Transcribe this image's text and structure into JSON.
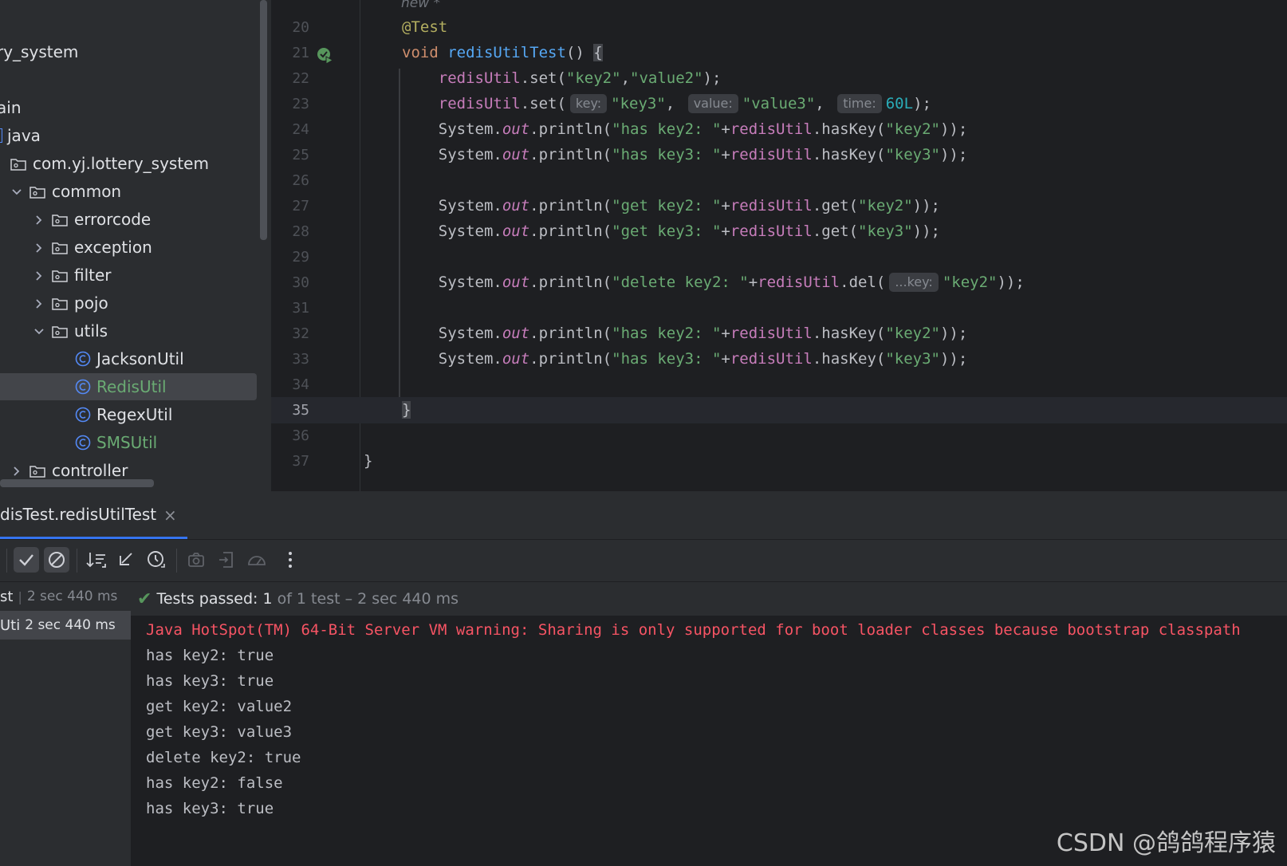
{
  "project_tree": [
    {
      "label": "ry_system",
      "type": "text",
      "depth": -1
    },
    {
      "label": "ain",
      "type": "text",
      "depth": -1
    },
    {
      "label": "java",
      "type": "src-folder",
      "depth": -1
    },
    {
      "label": "com.yj.lottery_system",
      "type": "package",
      "depth": 0
    },
    {
      "label": "common",
      "type": "folder",
      "depth": 1,
      "expanded": true
    },
    {
      "label": "errorcode",
      "type": "folder",
      "depth": 2,
      "expanded": false
    },
    {
      "label": "exception",
      "type": "folder",
      "depth": 2,
      "expanded": false
    },
    {
      "label": "filter",
      "type": "folder",
      "depth": 2,
      "expanded": false
    },
    {
      "label": "pojo",
      "type": "folder",
      "depth": 2,
      "expanded": false
    },
    {
      "label": "utils",
      "type": "folder",
      "depth": 2,
      "expanded": true
    },
    {
      "label": "JacksonUtil",
      "type": "class",
      "depth": 3,
      "vcs": "normal"
    },
    {
      "label": "RedisUtil",
      "type": "class",
      "depth": 3,
      "vcs": "added",
      "selected": true
    },
    {
      "label": "RegexUtil",
      "type": "class",
      "depth": 3,
      "vcs": "normal"
    },
    {
      "label": "SMSUtil",
      "type": "class",
      "depth": 3,
      "vcs": "added"
    },
    {
      "label": "controller",
      "type": "folder",
      "depth": 1,
      "expanded": false
    }
  ],
  "editor": {
    "usage_hint": "new *",
    "line_numbers": [
      "20",
      "21",
      "22",
      "23",
      "24",
      "25",
      "26",
      "27",
      "28",
      "29",
      "30",
      "31",
      "32",
      "33",
      "34",
      "35",
      "36",
      "37"
    ],
    "current_line": "35",
    "hints": {
      "key": "key:",
      "value": "value:",
      "time": "time:",
      "varargs_key": "...key:"
    },
    "tokens": {
      "annotation": "@Test",
      "void": "void",
      "method_name": "redisUtilTest",
      "parens_open": "() {",
      "redisUtil": "redisUtil",
      "set": ".set(",
      "key2": "\"key2\"",
      "value2": "\"value2\"",
      "key3": "\"key3\"",
      "value3": "\"value3\"",
      "sixty": "60L",
      "close_semi": ");",
      "close_close_semi": "));",
      "comma": ",",
      "system": "System.",
      "out": "out",
      "println": ".println(",
      "has_key2": "\"has key2: \"",
      "has_key3": "\"has key3: \"",
      "get_key2": "\"get key2: \"",
      "get_key3": "\"get key3: \"",
      "delete_key2": "\"delete key2: \"",
      "plus": "+",
      "hasKey": ".hasKey(",
      "get": ".get(",
      "del": ".del(",
      "close_brace": "}"
    }
  },
  "run_panel": {
    "tab_label": "disTest.redisUtilTest",
    "tab_close": "×",
    "test_tree": [
      {
        "name": "st",
        "time": "2 sec 440 ms",
        "separator": "|"
      },
      {
        "name": "Uti",
        "time": "2 sec 440 ms",
        "selected": true
      }
    ],
    "status": {
      "passed": "Tests passed: 1",
      "rest": "of 1 test – 2 sec 440 ms"
    },
    "console": [
      {
        "text": "Java HotSpot(TM) 64-Bit Server VM warning: Sharing is only supported for boot loader classes because bootstrap classpath",
        "kind": "warn"
      },
      {
        "text": "has key2: true",
        "kind": "out"
      },
      {
        "text": "has key3: true",
        "kind": "out"
      },
      {
        "text": "get key2: value2",
        "kind": "out"
      },
      {
        "text": "get key3: value3",
        "kind": "out"
      },
      {
        "text": "delete key2: true",
        "kind": "out"
      },
      {
        "text": "has key2: false",
        "kind": "out"
      },
      {
        "text": "has key3: true",
        "kind": "out"
      }
    ]
  },
  "watermark": "CSDN @鸽鸽程序猿",
  "colors": {
    "vcs_added": "#6aab73",
    "accent": "#3574f0",
    "passed": "#57965c",
    "warning": "#f75464"
  }
}
